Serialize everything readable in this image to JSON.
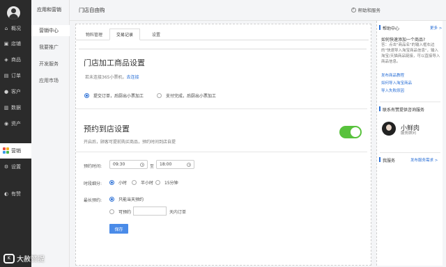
{
  "left_nav": {
    "items": [
      {
        "label": "概况",
        "icon": "home-icon"
      },
      {
        "label": "店铺",
        "icon": "store-icon"
      },
      {
        "label": "商品",
        "icon": "tag-icon"
      },
      {
        "label": "订单",
        "icon": "order-icon"
      },
      {
        "label": "客户",
        "icon": "customer-icon"
      },
      {
        "label": "数据",
        "icon": "chart-icon"
      },
      {
        "label": "资产",
        "icon": "asset-icon"
      },
      {
        "label": "营销",
        "icon": "marketing-icon"
      },
      {
        "label": "设置",
        "icon": "gear-icon"
      },
      {
        "label": "有赞",
        "icon": "youzan-logo-icon"
      }
    ]
  },
  "sub_nav": {
    "title": "应用和营销",
    "items": [
      "营销中心",
      "我要推广",
      "开发服务",
      "应用市场"
    ]
  },
  "header": {
    "title": "门店自由购",
    "help": "帮助和服务"
  },
  "tabs": [
    "物料管理",
    "交易记录",
    "设置"
  ],
  "processing": {
    "title": "门店加工商品设置",
    "desc_prefix": "若未连接365小票机，",
    "desc_link": "去连接",
    "option1": "提交订单，后厨出小票加工",
    "option2": "支付完成，后厨出小票加工"
  },
  "pickup": {
    "title": "预约到店设置",
    "desc": "开启后，顾客可提前购买商品，预约时间到店自提",
    "time_label": "预约时间:",
    "start_time": "09:30",
    "to_label": "至",
    "end_time": "18:00",
    "split_label": "时段细分:",
    "split_options": [
      "小时",
      "半小时",
      "15分钟"
    ],
    "max_label": "最长预约:",
    "max_options": [
      "只能当天预约",
      "可预约"
    ],
    "days_suffix": "天内订单",
    "save_button": "保存"
  },
  "right_panel": {
    "help_title": "帮助中心",
    "more1": "更多 >",
    "question": "如何快速添加一个商品?",
    "answer": "答：点击\"商品名\"的输入框右边的\"快速导入淘宝商品信息\"，输入淘宝/天猫商品链接，可以直接导入商品信息。",
    "links": [
      "发布商品教程",
      "如何导入淘宝商品",
      "导入失败原因"
    ],
    "contact_title": "联系有赞提供咨询服务",
    "service_name": "小鲜肉",
    "service_role": "服务顾问",
    "my_service": "我服务",
    "more2": "发布服务需求 >"
  },
  "watermark": "大赦赞提"
}
